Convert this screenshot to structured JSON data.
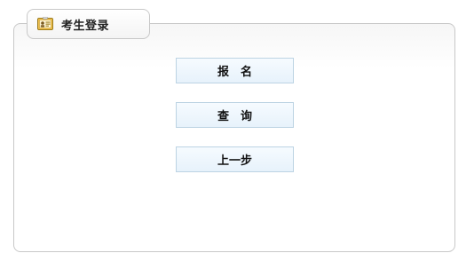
{
  "panel": {
    "title": "考生登录",
    "icon": "id-card-icon"
  },
  "actions": {
    "register_label": "报　名",
    "query_label": "查　询",
    "back_label": "上一步"
  },
  "colors": {
    "button_border": "#bcd3e3",
    "button_fill": "#e7f2fb",
    "panel_border": "#c8c8c8"
  }
}
